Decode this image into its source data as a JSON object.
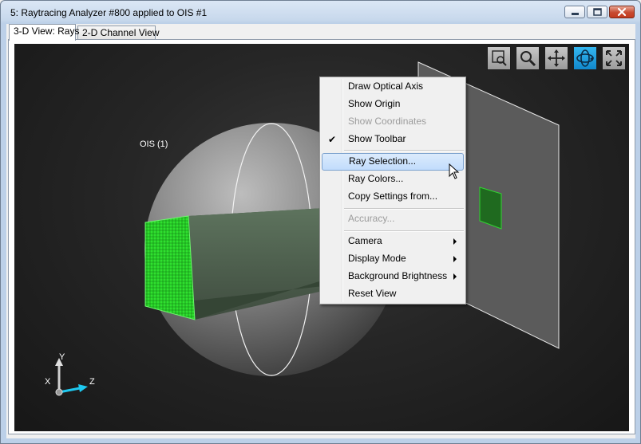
{
  "window": {
    "title": "5: Raytracing Analyzer #800 applied to OIS #1",
    "min_icon": "minimize-icon",
    "max_icon": "maximize-icon",
    "close_icon": "close-icon"
  },
  "tabs": [
    {
      "label": "3-D View: Rays",
      "active": true
    },
    {
      "label": "2-D Channel View",
      "active": false
    }
  ],
  "scene": {
    "object_label": "OIS (1)",
    "axes": {
      "y": "Y",
      "x": "X",
      "z": "Z"
    }
  },
  "toolbar": {
    "buttons": [
      {
        "icon": "zoom-box-icon",
        "active": false
      },
      {
        "icon": "zoom-icon",
        "active": false
      },
      {
        "icon": "pan-icon",
        "active": false
      },
      {
        "icon": "rotate-icon",
        "active": true
      },
      {
        "icon": "fit-to-view-icon",
        "active": false
      }
    ]
  },
  "context_menu": {
    "items": [
      {
        "label": "Draw Optical Axis"
      },
      {
        "label": "Show Origin"
      },
      {
        "label": "Show Coordinates",
        "disabled": true
      },
      {
        "label": "Show Toolbar",
        "checked": true
      },
      {
        "label": "Ray Selection...",
        "highlighted": true
      },
      {
        "label": "Ray Colors..."
      },
      {
        "label": "Copy Settings from..."
      },
      {
        "label": "Accuracy...",
        "disabled": true
      },
      {
        "label": "Camera",
        "submenu": true
      },
      {
        "label": "Display Mode",
        "submenu": true
      },
      {
        "label": "Background Brightness",
        "submenu": true
      },
      {
        "label": "Reset View"
      }
    ]
  },
  "colors": {
    "ray_green": "#39e83a",
    "accent_blue": "#1ea5e6",
    "background": "#262626"
  }
}
